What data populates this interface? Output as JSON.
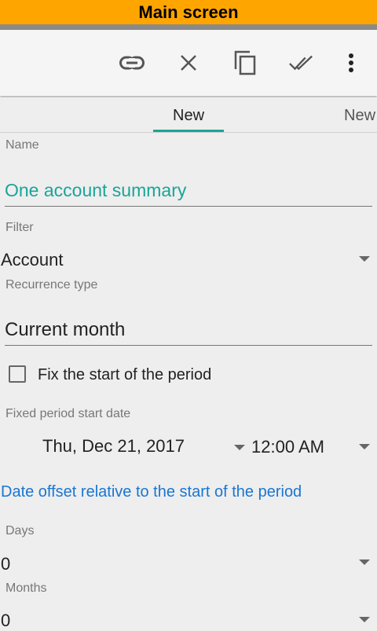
{
  "banner": {
    "title": "Main screen"
  },
  "toolbar": {
    "icons": [
      "link-icon",
      "close-icon",
      "copy-icon",
      "done-all-icon",
      "more-vert-icon"
    ]
  },
  "tabs": [
    {
      "label": "New",
      "selected": true
    },
    {
      "label": "New",
      "selected": false
    }
  ],
  "form": {
    "name_label": "Name",
    "name_value": "One account summary",
    "filter_label": "Filter",
    "filter_value": "Account",
    "recurrence_label": "Recurrence type",
    "recurrence_value": "Current month",
    "fix_start_label": "Fix the start of the period",
    "fix_start_checked": false,
    "fixed_start_label": "Fixed period start date",
    "fixed_start_date": "Thu, Dec 21, 2017",
    "fixed_start_time": "12:00 AM",
    "offset_link": "Date offset relative to the start of the period",
    "days_label": "Days",
    "days_value": "0",
    "months_label": "Months",
    "months_value": "0"
  },
  "colors": {
    "banner": "#ffa500",
    "accent": "#1aa597",
    "link": "#1976d2"
  }
}
